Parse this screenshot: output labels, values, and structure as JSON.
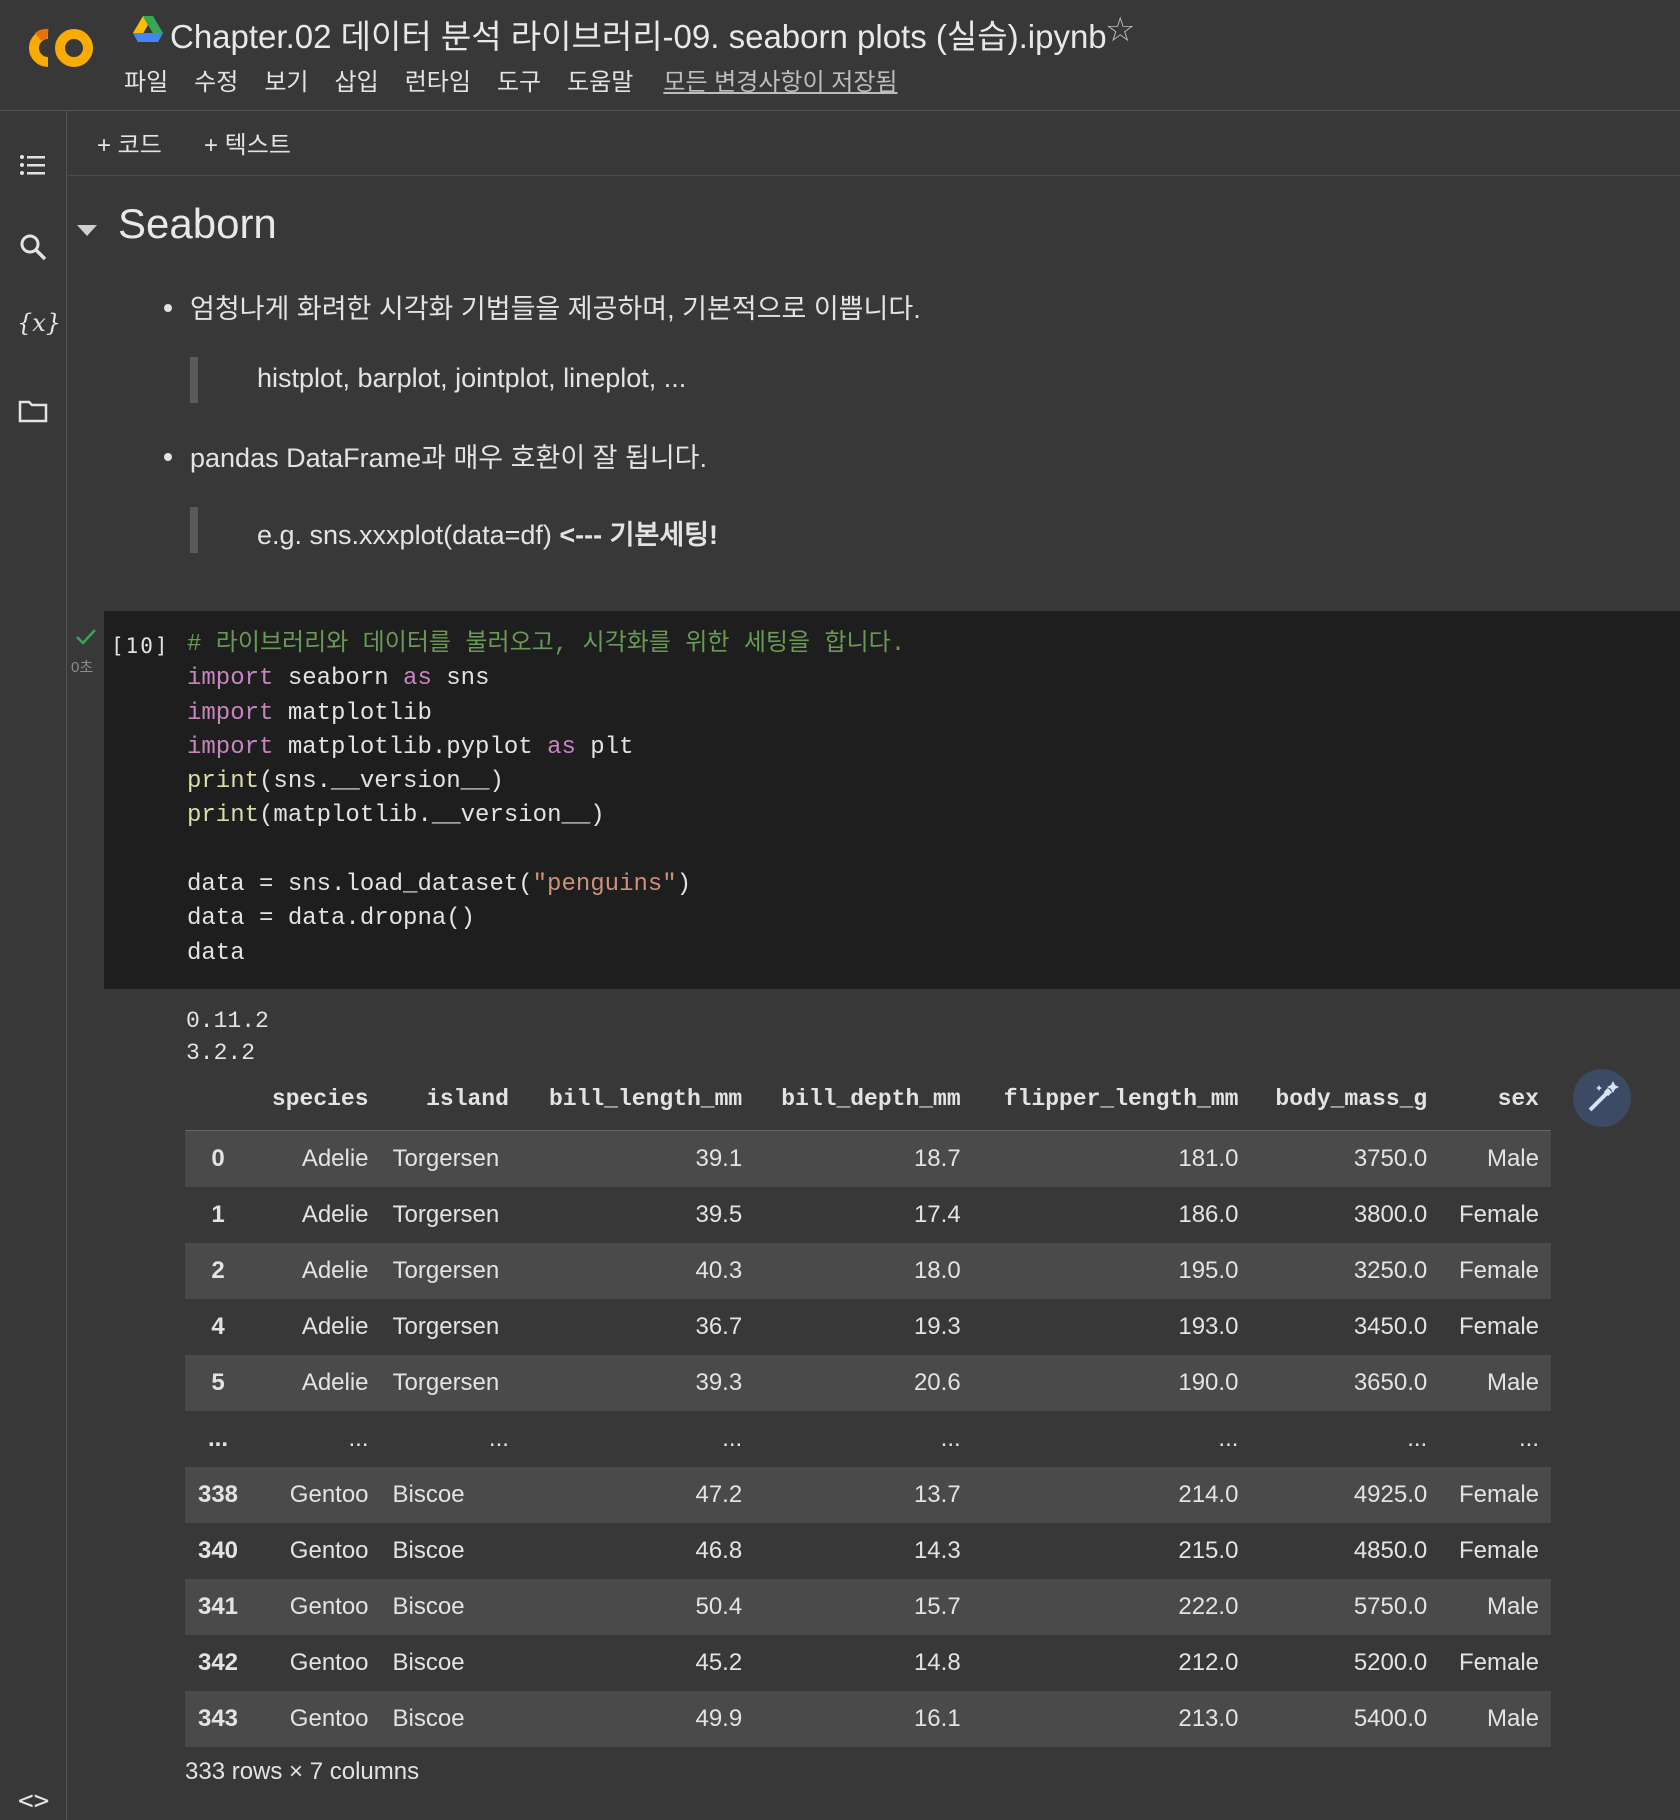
{
  "header": {
    "title": "Chapter.02 데이터 분석 라이브러리-09. seaborn plots (실습).ipynb",
    "menu": [
      "파일",
      "수정",
      "보기",
      "삽입",
      "런타임",
      "도구",
      "도움말"
    ],
    "saved_status": "모든 변경사항이 저장됨"
  },
  "toolbar": {
    "add_code": "+ 코드",
    "add_text": "+ 텍스트"
  },
  "sidebar_icons": [
    "toc-icon",
    "search-icon",
    "variables-icon",
    "folder-icon"
  ],
  "text_cell": {
    "heading": "Seaborn",
    "bullet1": "엄청나게 화려한 시각화 기법들을 제공하며, 기본적으로 이쁩니다.",
    "quote1": "histplot, barplot, jointplot, lineplot, ...",
    "bullet2": "pandas DataFrame과 매우 호환이 잘 됩니다.",
    "quote2_plain": "e.g. sns.xxxplot(data=df) ",
    "quote2_bold": "<--- 기본세팅!"
  },
  "code_cell": {
    "exec_count": "[10]",
    "exec_time": "0초",
    "lines": [
      "# 라이브러리와 데이터를 불러오고, 시각화를 위한 세팅을 합니다.",
      "import seaborn as sns",
      "import matplotlib",
      "import matplotlib.pyplot as plt",
      "print(sns.__version__)",
      "print(matplotlib.__version__)",
      "",
      "data = sns.load_dataset(\"penguins\")",
      "data = data.dropna()",
      "data"
    ]
  },
  "output": {
    "stdout": [
      "0.11.2",
      "3.2.2"
    ],
    "table": {
      "columns": [
        "",
        "species",
        "island",
        "bill_length_mm",
        "bill_depth_mm",
        "flipper_length_mm",
        "body_mass_g",
        "sex"
      ],
      "rows": [
        [
          "0",
          "Adelie",
          "Torgersen",
          "39.1",
          "18.7",
          "181.0",
          "3750.0",
          "Male"
        ],
        [
          "1",
          "Adelie",
          "Torgersen",
          "39.5",
          "17.4",
          "186.0",
          "3800.0",
          "Female"
        ],
        [
          "2",
          "Adelie",
          "Torgersen",
          "40.3",
          "18.0",
          "195.0",
          "3250.0",
          "Female"
        ],
        [
          "4",
          "Adelie",
          "Torgersen",
          "36.7",
          "19.3",
          "193.0",
          "3450.0",
          "Female"
        ],
        [
          "5",
          "Adelie",
          "Torgersen",
          "39.3",
          "20.6",
          "190.0",
          "3650.0",
          "Male"
        ],
        [
          "...",
          "...",
          "...",
          "...",
          "...",
          "...",
          "...",
          "..."
        ],
        [
          "338",
          "Gentoo",
          "Biscoe",
          "47.2",
          "13.7",
          "214.0",
          "4925.0",
          "Female"
        ],
        [
          "340",
          "Gentoo",
          "Biscoe",
          "46.8",
          "14.3",
          "215.0",
          "4850.0",
          "Female"
        ],
        [
          "341",
          "Gentoo",
          "Biscoe",
          "50.4",
          "15.7",
          "222.0",
          "5750.0",
          "Male"
        ],
        [
          "342",
          "Gentoo",
          "Biscoe",
          "45.2",
          "14.8",
          "212.0",
          "5200.0",
          "Female"
        ],
        [
          "343",
          "Gentoo",
          "Biscoe",
          "49.9",
          "16.1",
          "213.0",
          "5400.0",
          "Male"
        ]
      ]
    },
    "summary": "333 rows × 7 columns"
  },
  "colors": {
    "background": "#383838",
    "code_bg": "#1e1e1e",
    "keyword": "#c586c0",
    "function": "#dcdcaa",
    "string": "#ce9178",
    "comment": "#6a9955",
    "check": "#34a853"
  }
}
